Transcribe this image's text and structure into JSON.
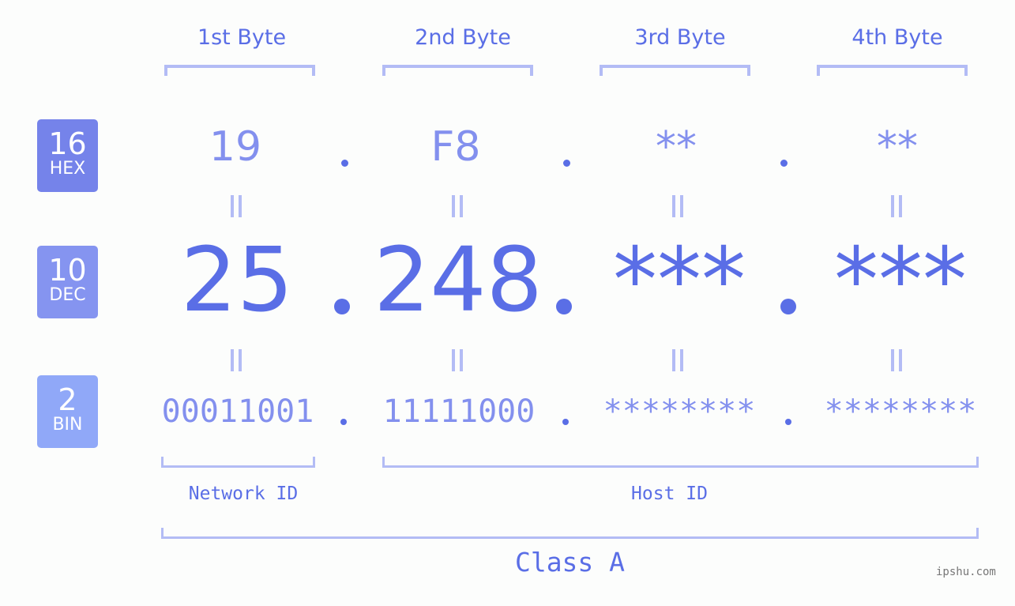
{
  "byte_headers": [
    "1st Byte",
    "2nd Byte",
    "3rd Byte",
    "4th Byte"
  ],
  "badges": {
    "hex": {
      "number": "16",
      "label": "HEX",
      "color": "#7583ea"
    },
    "dec": {
      "number": "10",
      "label": "DEC",
      "color": "#8594f0"
    },
    "bin": {
      "number": "2",
      "label": "BIN",
      "color": "#90a8f8"
    }
  },
  "hex_values": [
    "19",
    "F8",
    "**",
    "**"
  ],
  "dec_values": [
    "25",
    "248",
    "***",
    "***"
  ],
  "bin_values": [
    "00011001",
    "11111000",
    "********",
    "********"
  ],
  "network_id_label": "Network ID",
  "host_id_label": "Host ID",
  "class_label": "Class A",
  "watermark": "ipshu.com",
  "colors": {
    "accent": "#5a6ee6",
    "light_accent": "#8390ee",
    "bracket": "#b3bcf5",
    "background": "#fcfdfc"
  }
}
